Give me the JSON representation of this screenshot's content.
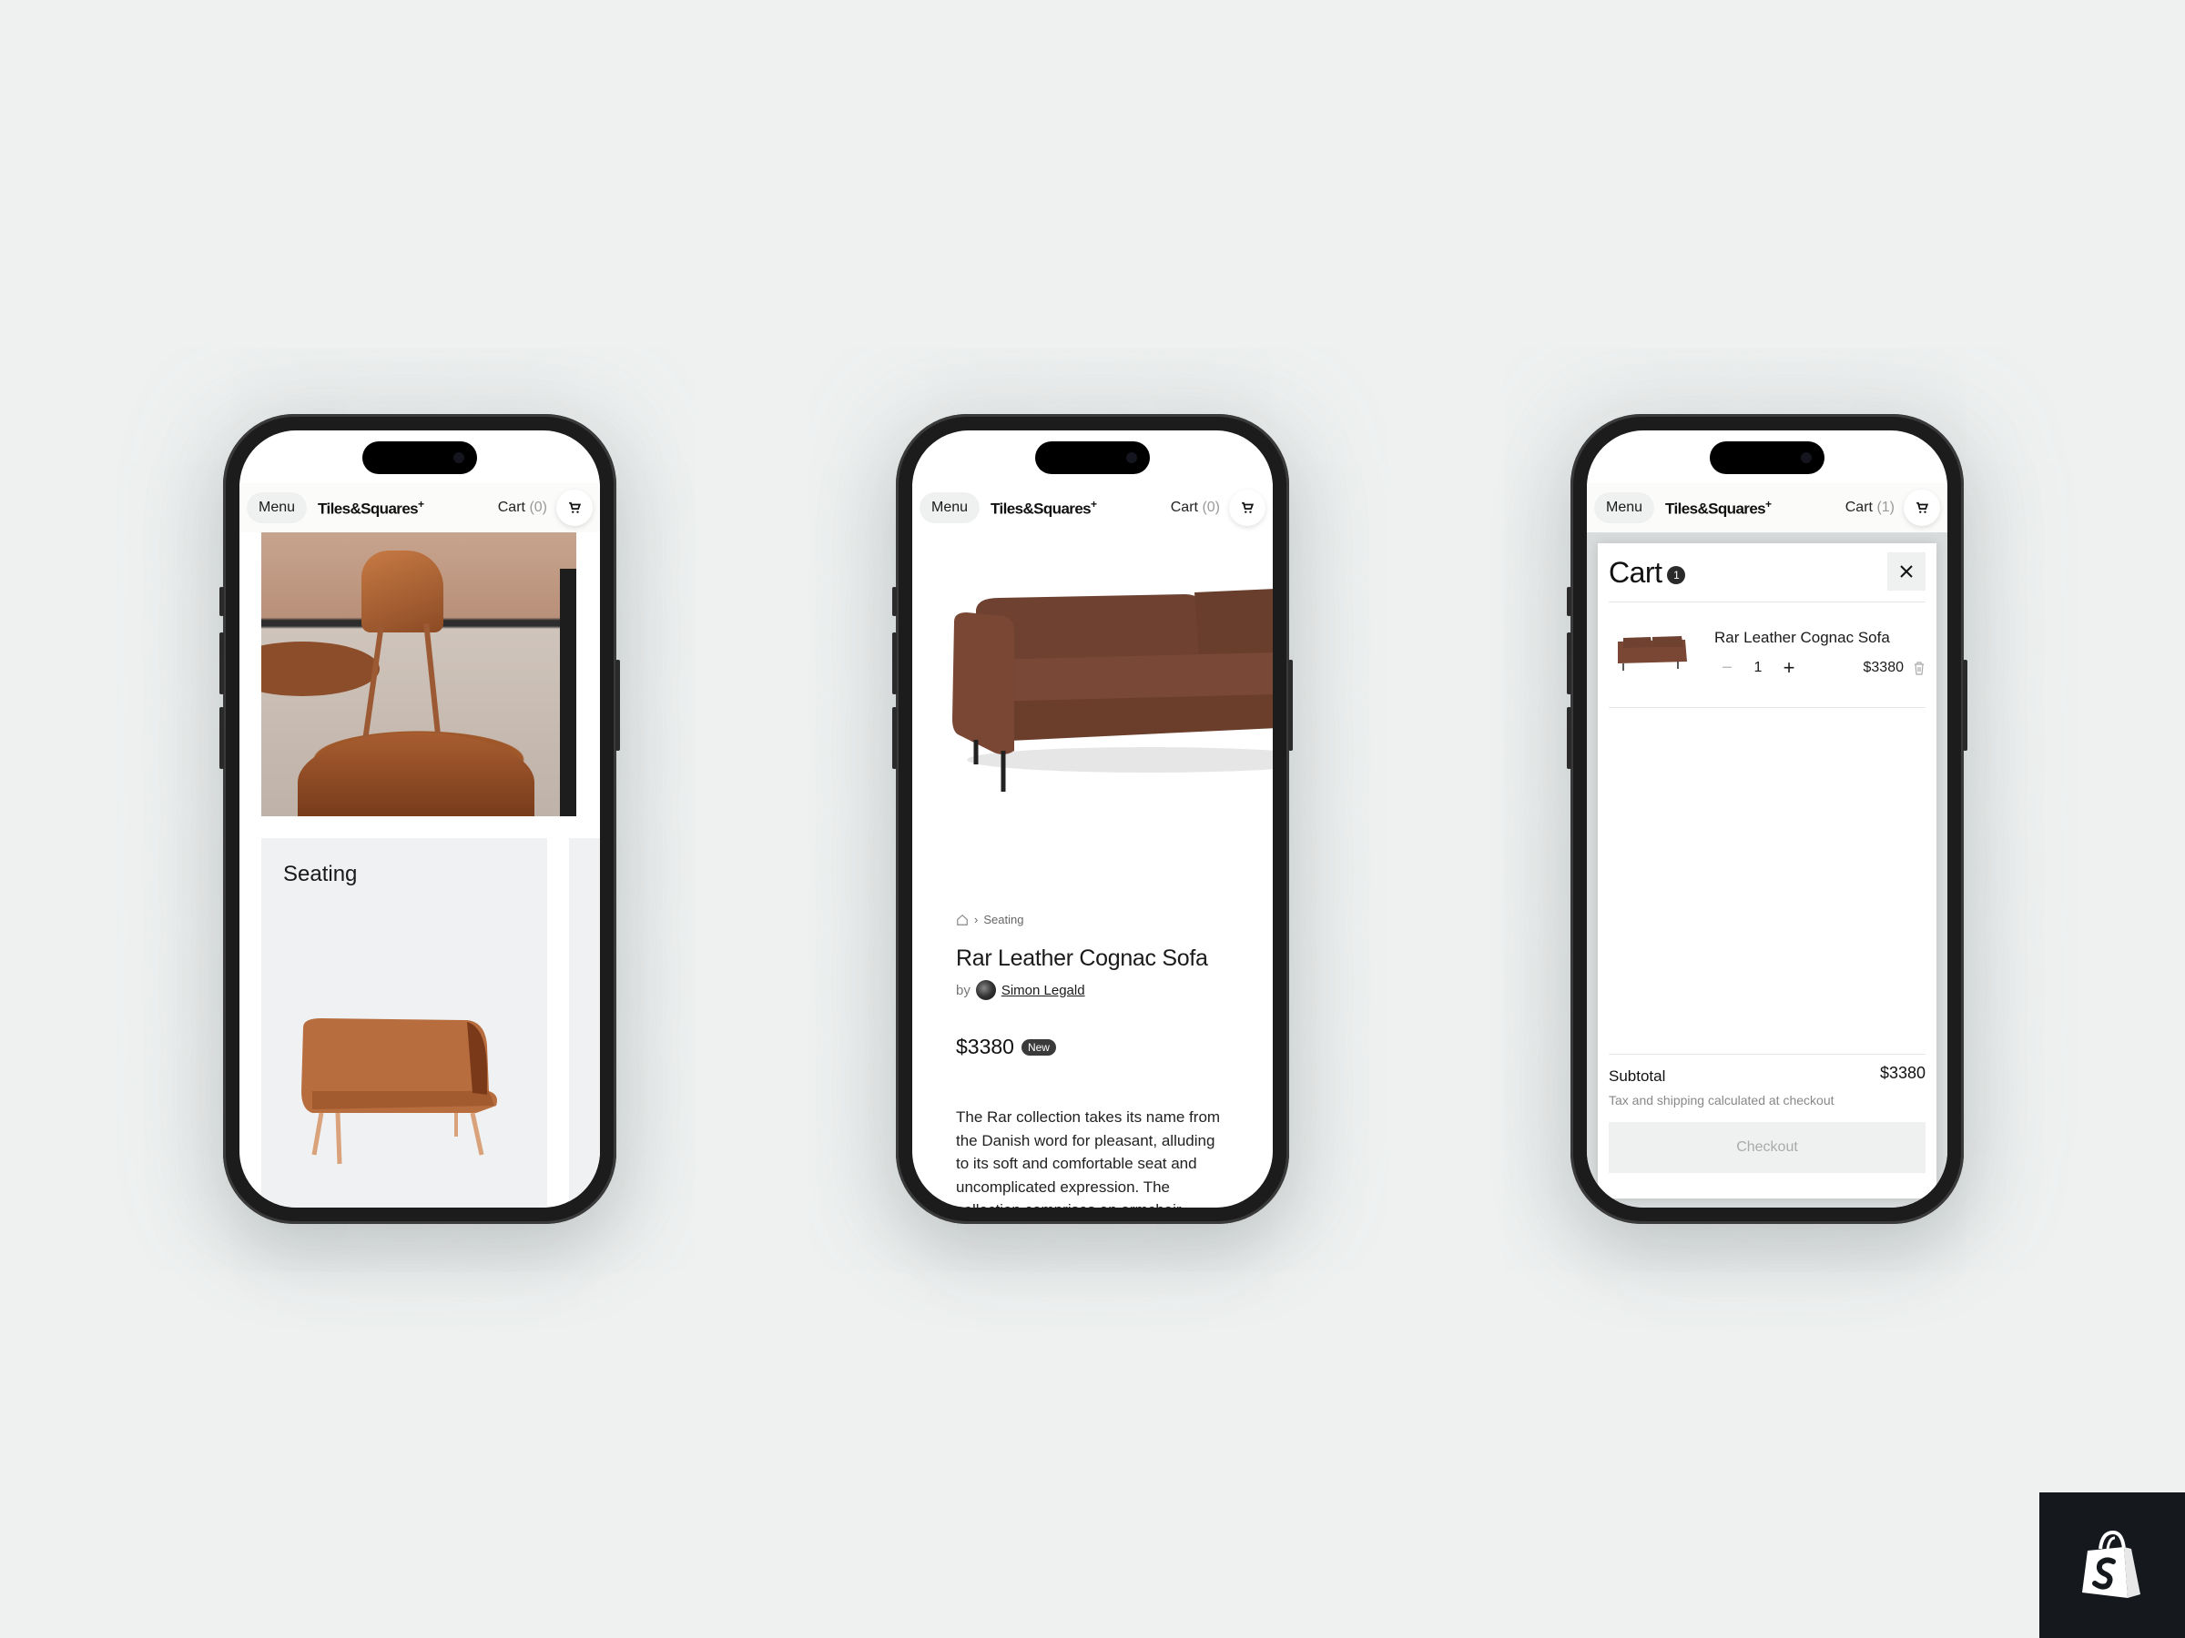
{
  "header": {
    "menu_label": "Menu",
    "brand": "Tiles&Squares",
    "brand_sup": "+",
    "cart_label": "Cart",
    "cart_count_empty": "(0)",
    "cart_count_filled": "(1)",
    "cart_icon": "shopping-cart-icon"
  },
  "home": {
    "category_title": "Seating"
  },
  "product": {
    "breadcrumb_home_icon": "home-icon",
    "breadcrumb_separator": "›",
    "breadcrumb_category": "Seating",
    "title": "Rar Leather Cognac Sofa",
    "by_label": "by",
    "author": "Simon Legald",
    "price": "$3380",
    "badge": "New",
    "description": "The Rar collection takes its name from the Danish word for pleasant, alluding to its soft and comfortable seat and uncomplicated expression. The collection comprises an armchair,"
  },
  "cart": {
    "title": "Cart",
    "count": "1",
    "close_icon": "close-icon",
    "items": [
      {
        "name": "Rar Leather Cognac Sofa",
        "quantity": "1",
        "minus": "−",
        "plus": "+",
        "price": "$3380",
        "remove_icon": "trash-icon"
      }
    ],
    "subtotal_label": "Subtotal",
    "subtotal_value": "$3380",
    "tax_note": "Tax and shipping calculated at checkout",
    "checkout_label": "Checkout"
  },
  "branding": {
    "logo": "shopify-bag-icon"
  },
  "colors": {
    "background": "#eff1f1",
    "phone_frame": "#1c1c1c",
    "badge_bg": "#3a3a3a",
    "logo_tile": "#15181c",
    "checkout_bg": "#eff1f1"
  }
}
